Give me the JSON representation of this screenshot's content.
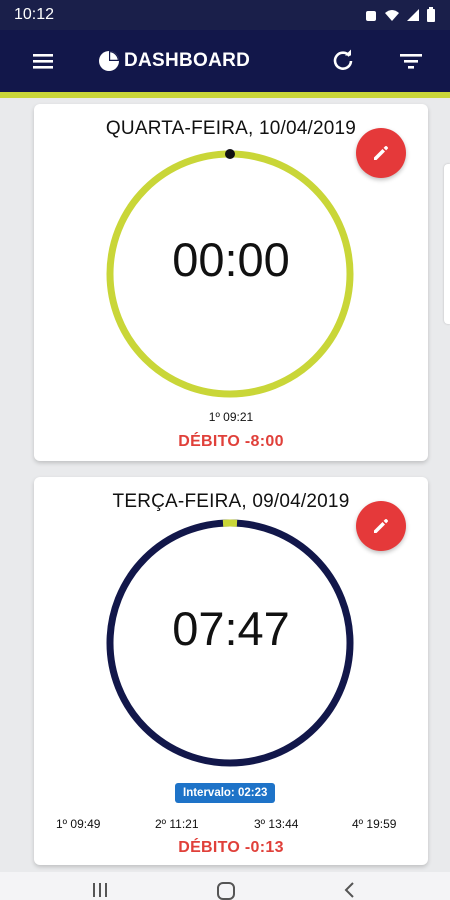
{
  "status_bar": {
    "time": "10:12"
  },
  "app_bar": {
    "title": "DASHBOARD"
  },
  "cards": [
    {
      "date": "QUARTA-FEIRA, 10/04/2019",
      "timer": "00:00",
      "punches": [
        "1º 09:21"
      ],
      "debit": "DÉBITO -8:00",
      "ring_color": "#c9d638",
      "ring_progress": 0
    },
    {
      "date": "TERÇA-FEIRA, 09/04/2019",
      "timer": "07:47",
      "interval": "Intervalo: 02:23",
      "punches": [
        "1º 09:49",
        "2º 11:21",
        "3º 13:44",
        "4º 19:59"
      ],
      "debit": "DÉBITO -0:13",
      "ring_color": "#12174a",
      "ring_progress": 0.97
    }
  ],
  "colors": {
    "app_bar": "#12174a",
    "accent": "#c9d638",
    "fab": "#e5393a",
    "debit_text": "#e0403a",
    "interval_badge": "#1e73c8"
  },
  "icons": [
    "menu-icon",
    "pie-chart-icon",
    "refresh-icon",
    "filter-icon",
    "edit-icon",
    "recent-apps-icon",
    "home-icon",
    "back-icon"
  ]
}
